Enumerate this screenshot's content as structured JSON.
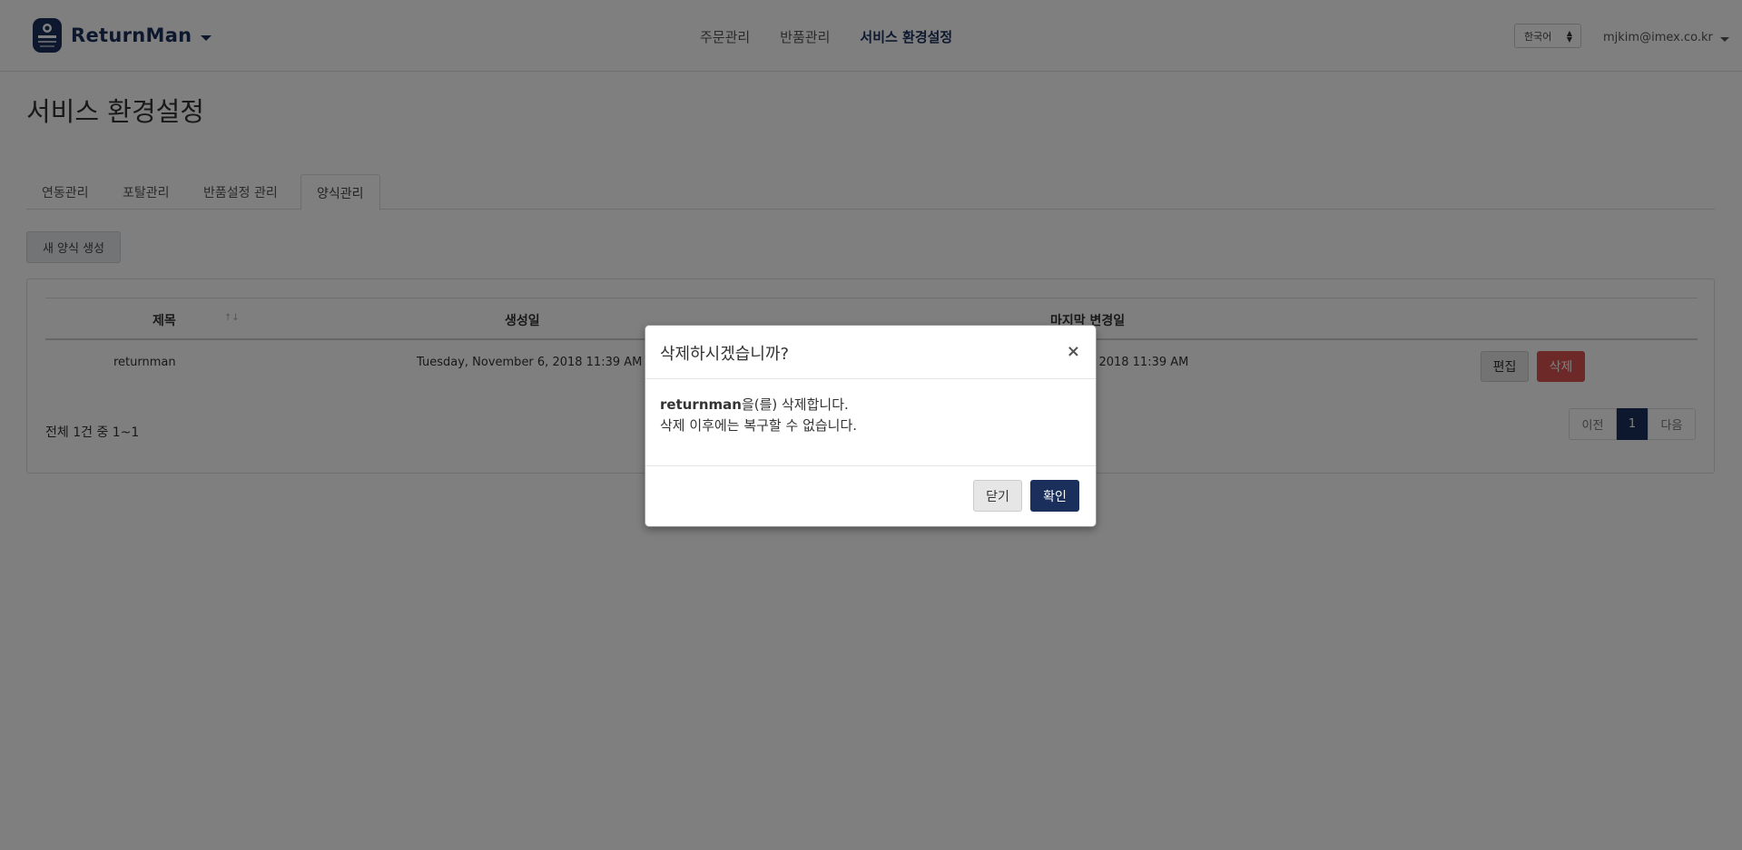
{
  "header": {
    "brand": "ReturnMan",
    "nav": [
      "주문관리",
      "반품관리",
      "서비스 환경설정"
    ],
    "active_nav": "서비스 환경설정",
    "language": "한국어",
    "user_email": "mjkim@imex.co.kr"
  },
  "page": {
    "title": "서비스 환경설정",
    "tabs": [
      "연동관리",
      "포탈관리",
      "반품설정 관리",
      "양식관리"
    ],
    "active_tab": "양식관리",
    "new_button": "새 양식 생성"
  },
  "table": {
    "columns": [
      "제목",
      "생성일",
      "마지막 변경일"
    ],
    "sort_icon": "↑↓",
    "rows": [
      {
        "title": "returnman",
        "created": "Tuesday, November 6, 2018 11:39 AM",
        "modified": "Tuesday, November 6, 2018 11:39 AM",
        "edit_label": "편집",
        "delete_label": "삭제"
      }
    ],
    "summary": "전체 1건 중 1~1",
    "pagination": {
      "prev": "이전",
      "current": "1",
      "next": "다음"
    }
  },
  "modal": {
    "title": "삭제하시겠습니까?",
    "close_symbol": "×",
    "item_name": "returnman",
    "line1_suffix": "을(를) 삭제합니다.",
    "line2": "삭제 이후에는 복구할 수 없습니다.",
    "close_label": "닫기",
    "confirm_label": "확인"
  },
  "colors": {
    "brand": "#1b2f5c",
    "danger": "#d9534f",
    "overlay": "rgba(0,0,0,0.5)"
  }
}
